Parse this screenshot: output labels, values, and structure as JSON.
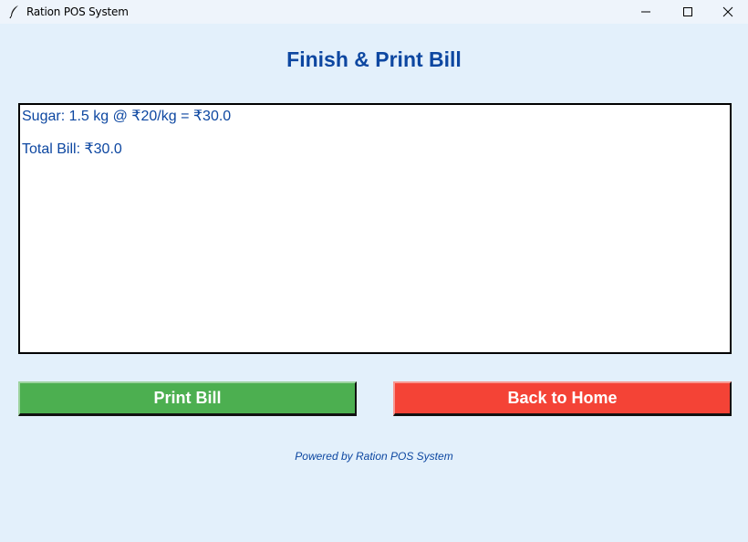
{
  "window": {
    "title": "Ration POS System",
    "icon": "feather-icon"
  },
  "heading": "Finish & Print Bill",
  "bill": {
    "lines": [
      "Sugar: 1.5 kg @ ₹20/kg = ₹30.0",
      "Total Bill: ₹30.0"
    ]
  },
  "buttons": {
    "print_label": "Print Bill",
    "home_label": "Back to Home"
  },
  "footer": "Powered by Ration POS System",
  "colors": {
    "background": "#e3f0fb",
    "text_accent": "#0d47a1",
    "print_button": "#4caf50",
    "home_button": "#f44336"
  }
}
